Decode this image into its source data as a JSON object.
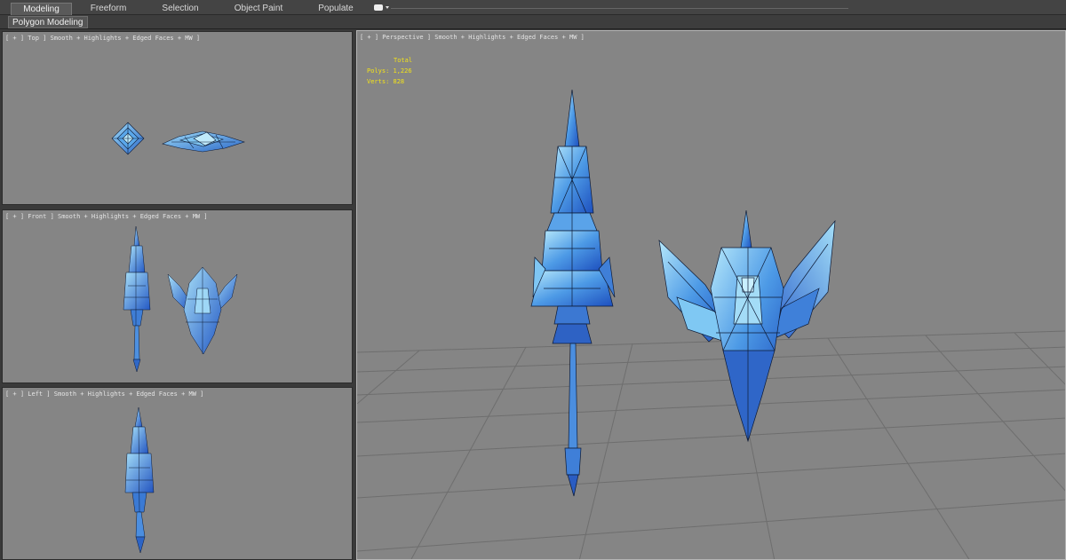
{
  "ribbon": {
    "tabs": [
      {
        "label": "Modeling",
        "active": true
      },
      {
        "label": "Freeform"
      },
      {
        "label": "Selection"
      },
      {
        "label": "Object Paint"
      },
      {
        "label": "Populate"
      }
    ],
    "panel_label": "Polygon Modeling"
  },
  "viewports": {
    "top": {
      "label": "[ + ] Top ] Smooth + Highlights + Edged Faces + MW ]"
    },
    "front": {
      "label": "[ + ] Front ] Smooth + Highlights + Edged Faces + MW ]"
    },
    "left": {
      "label": "[ + ] Left ] Smooth + Highlights + Edged Faces + MW ]"
    },
    "perspective": {
      "label": "[ + ] Perspective ] Smooth + Highlights + Edged Faces + MW ]"
    }
  },
  "stats": {
    "total": "Total",
    "polys": "Polys: 1,226",
    "verts": "Verts: 828"
  },
  "colors": {
    "viewport_bg": "#858585",
    "model_blue": "#3c84d9",
    "model_light": "#8fd2f5",
    "wire": "#0d1a35",
    "stats_yellow": "#f2e21a"
  }
}
